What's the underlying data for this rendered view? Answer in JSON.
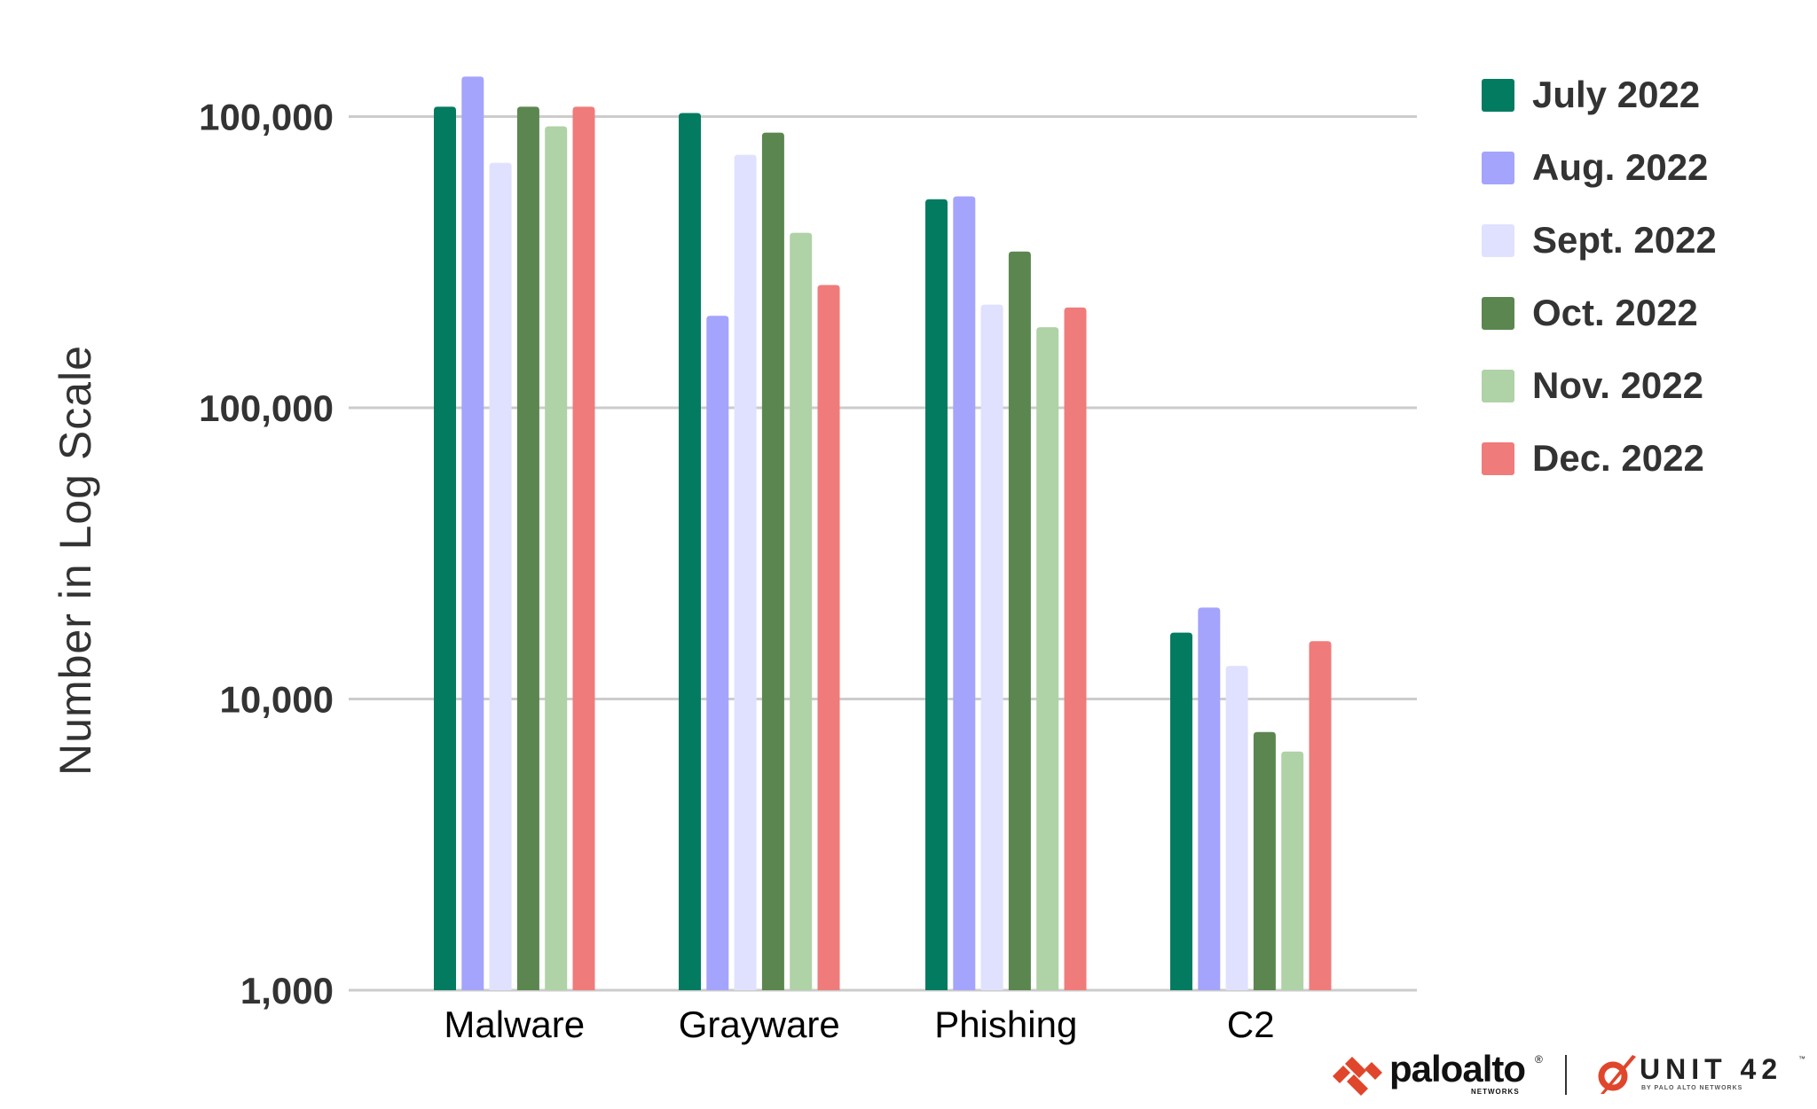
{
  "chart_data": {
    "type": "bar",
    "scale": "log",
    "title": "",
    "xlabel": "",
    "ylabel": "Number in Log Scale",
    "ylim": [
      1000,
      1500000
    ],
    "y_ticks": [
      {
        "value": 1000,
        "label": "1,000"
      },
      {
        "value": 10000,
        "label": "10,000"
      },
      {
        "value": 100000,
        "label": "100,000"
      },
      {
        "value": 1000000,
        "label": "100,000"
      }
    ],
    "grid": true,
    "legend_position": "top-right",
    "categories": [
      "Malware",
      "Grayware",
      "Phishing",
      "C2"
    ],
    "series": [
      {
        "name": "July 2022",
        "color": "#037b61",
        "values": [
          1081000,
          1028000,
          520000,
          16900
        ]
      },
      {
        "name": "Aug. 2022",
        "color": "#a4a4fd",
        "values": [
          1372000,
          207000,
          532000,
          20600
        ]
      },
      {
        "name": "Sept. 2022",
        "color": "#e0e1ff",
        "values": [
          694000,
          739000,
          226000,
          13000
        ]
      },
      {
        "name": "Oct. 2022",
        "color": "#5b8650",
        "values": [
          1081000,
          881000,
          344000,
          7700
        ]
      },
      {
        "name": "Nov. 2022",
        "color": "#afd2a6",
        "values": [
          926000,
          399000,
          189000,
          6600
        ]
      },
      {
        "name": "Dec. 2022",
        "color": "#f07b7b",
        "values": [
          1081000,
          264000,
          221000,
          15800
        ]
      }
    ]
  },
  "branding": {
    "palo_alto": "paloalto",
    "palo_alto_reg": "®",
    "palo_alto_sub": "NETWORKS",
    "unit42": "UNIT 42",
    "unit42_tm": "™",
    "unit42_sub": "BY PALO ALTO NETWORKS",
    "brand_color": "#e0462b"
  }
}
